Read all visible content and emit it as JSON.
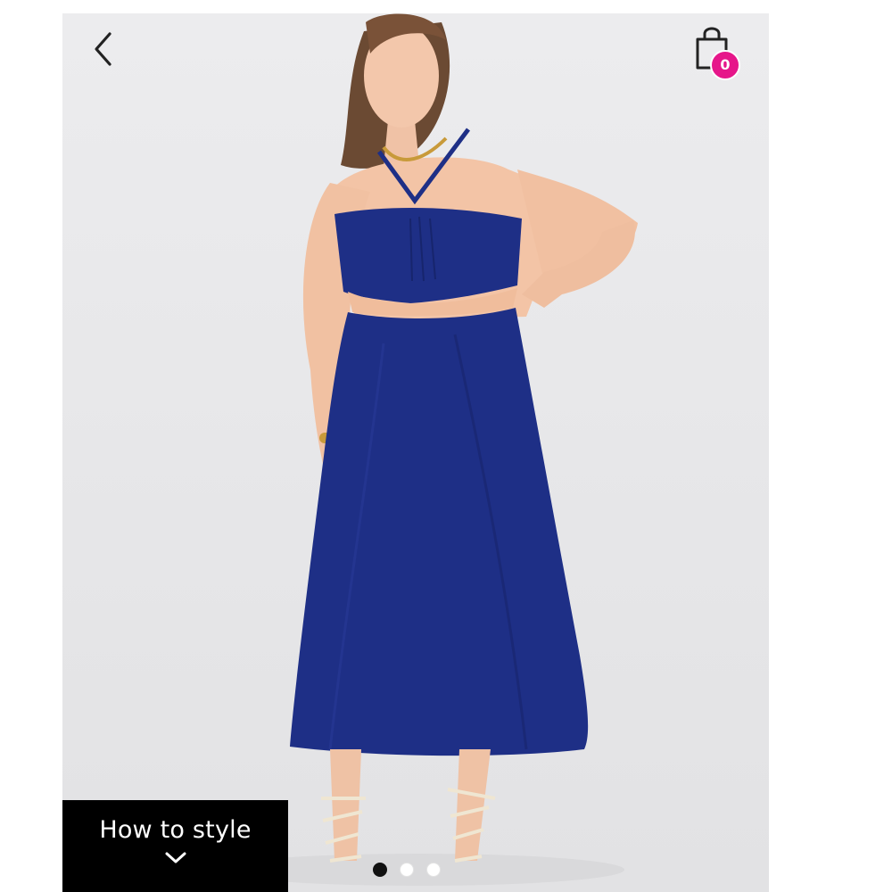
{
  "header": {
    "back_icon": "chevron-left-icon",
    "bag_icon": "shopping-bag-icon",
    "bag_count": "0",
    "badge_color": "#e6168a"
  },
  "product_image": {
    "dress_color": "#1e2f86",
    "background_color": "#e9e9eb"
  },
  "style_panel": {
    "label": "How to style",
    "chevron_icon": "chevron-down-icon"
  },
  "carousel": {
    "total_slides": 3,
    "active_slide": 1
  }
}
